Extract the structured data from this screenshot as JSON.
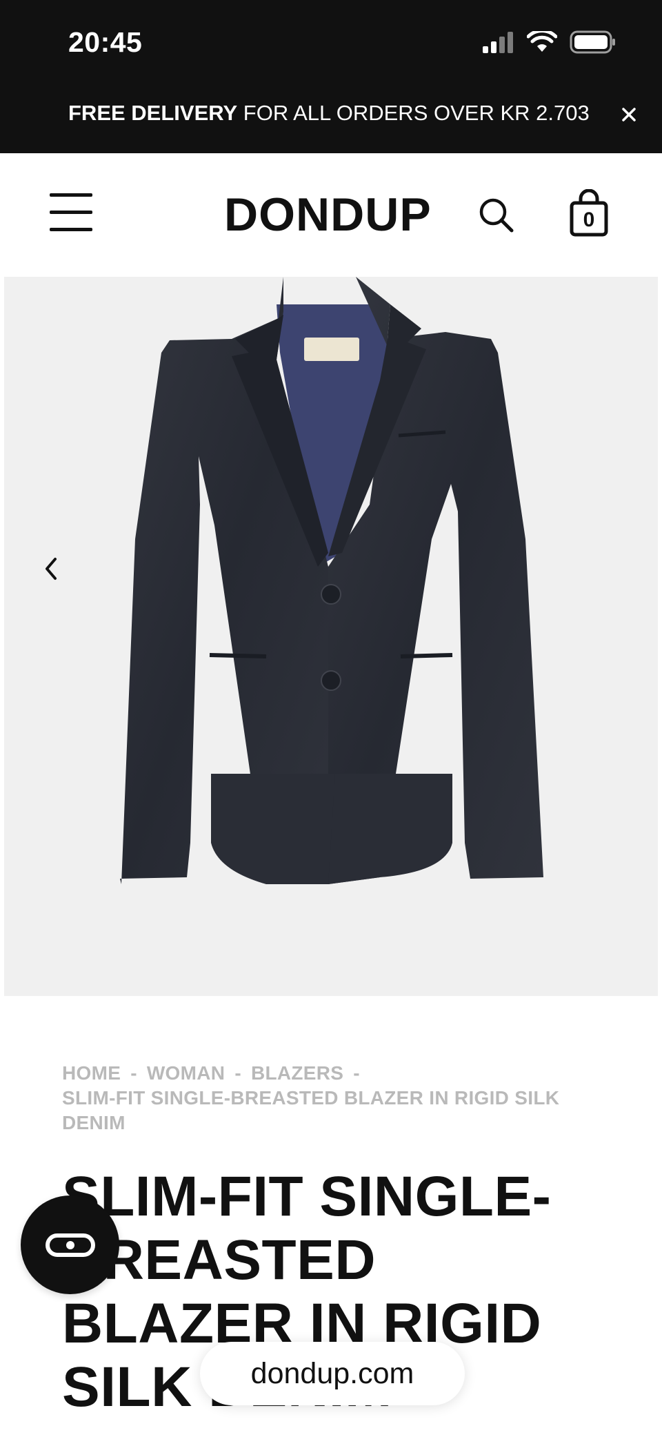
{
  "status_bar": {
    "time": "20:45",
    "icons": [
      "signal-icon",
      "wifi-icon",
      "battery-icon"
    ]
  },
  "promo": {
    "bold": "FREE DELIVERY",
    "text": " FOR ALL ORDERS OVER KR 2.703"
  },
  "header": {
    "logo": "DONDUP",
    "cart_count": "0",
    "icons": [
      "menu-icon",
      "search-icon",
      "shopping-bag-icon"
    ]
  },
  "product_image": {
    "description_icon": "blazer-image",
    "colors": {
      "background": "#f0f0f0",
      "jacket": "#2b2e38",
      "lining": "#3d4470"
    }
  },
  "breadcrumb": {
    "items": [
      "HOME",
      "WOMAN",
      "BLAZERS",
      "SLIM-FIT SINGLE-BREASTED BLAZER IN RIGID SILK DENIM"
    ],
    "separator": "-"
  },
  "product": {
    "title": "SLIM-FIT SINGLE-BREASTED BLAZER IN RIGID SILK DENIM"
  },
  "browser": {
    "url": "dondup.com"
  },
  "colors": {
    "topbar": "#111111",
    "breadcrumb": "#b9b9b9",
    "text": "#111111"
  }
}
